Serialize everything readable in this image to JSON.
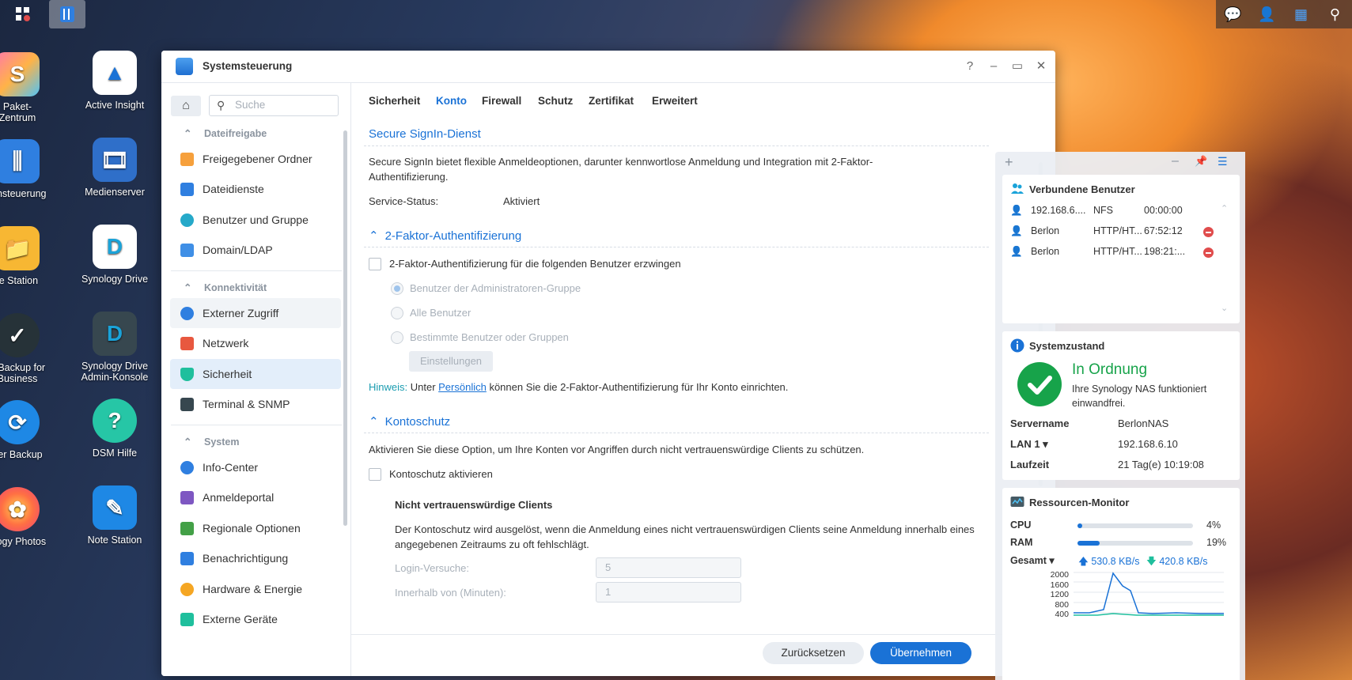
{
  "desktop": {
    "icons": [
      {
        "label": "Paket-\nZentrum"
      },
      {
        "label": "Active Insight"
      },
      {
        "label": "emsteuerung"
      },
      {
        "label": "Medienserver"
      },
      {
        "label": "le Station"
      },
      {
        "label": "Synology Drive"
      },
      {
        "label": "e Backup for\nBusiness"
      },
      {
        "label": "Synology Drive\nAdmin-Konsole"
      },
      {
        "label": "per Backup"
      },
      {
        "label": "DSM Hilfe"
      },
      {
        "label": "ology Photos"
      },
      {
        "label": "Note Station"
      }
    ]
  },
  "window": {
    "title": "Systemsteuerung",
    "controls": {
      "help": "?",
      "minimize": "–",
      "maximize": "▭",
      "close": "✕"
    }
  },
  "sidebar": {
    "search_placeholder": "Suche",
    "sections": [
      {
        "label": "Dateifreigabe"
      },
      {
        "label": "Konnektivität"
      },
      {
        "label": "System"
      }
    ],
    "items": [
      {
        "label": "Freigegebener Ordner"
      },
      {
        "label": "Dateidienste"
      },
      {
        "label": "Benutzer und Gruppe"
      },
      {
        "label": "Domain/LDAP"
      },
      {
        "label": "Externer Zugriff"
      },
      {
        "label": "Netzwerk"
      },
      {
        "label": "Sicherheit"
      },
      {
        "label": "Terminal & SNMP"
      },
      {
        "label": "Info-Center"
      },
      {
        "label": "Anmeldeportal"
      },
      {
        "label": "Regionale Optionen"
      },
      {
        "label": "Benachrichtigung"
      },
      {
        "label": "Hardware & Energie"
      },
      {
        "label": "Externe Geräte"
      }
    ]
  },
  "tabs": [
    {
      "label": "Sicherheit"
    },
    {
      "label": "Konto"
    },
    {
      "label": "Firewall"
    },
    {
      "label": "Schutz"
    },
    {
      "label": "Zertifikat"
    },
    {
      "label": "Erweitert"
    }
  ],
  "signin": {
    "title": "Secure SignIn-Dienst",
    "description": "Secure SignIn bietet flexible Anmeldeoptionen, darunter kennwortlose Anmeldung und Integration mit 2-Faktor-Authentifizierung.",
    "status_label": "Service-Status:",
    "status_value": "Aktiviert"
  },
  "twofa": {
    "title": "2-Faktor-Authentifizierung",
    "enforce_label": "2-Faktor-Authentifizierung für die folgenden Benutzer erzwingen",
    "options": [
      {
        "label": "Benutzer der Administratoren-Gruppe"
      },
      {
        "label": "Alle Benutzer"
      },
      {
        "label": "Bestimmte Benutzer oder Gruppen"
      }
    ],
    "settings_button": "Einstellungen",
    "hint_prefix": "Hinweis:",
    "hint_text_1": " Unter ",
    "hint_link": "Persönlich",
    "hint_text_2": " können Sie die 2-Faktor-Authentifizierung für Ihr Konto einrichten."
  },
  "account_protection": {
    "title": "Kontoschutz",
    "description": "Aktivieren Sie diese Option, um Ihre Konten vor Angriffen durch nicht vertrauenswürdige Clients zu schützen.",
    "enable_label": "Kontoschutz aktivieren",
    "untrusted_title": "Nicht vertrauenswürdige Clients",
    "untrusted_desc": "Der Kontoschutz wird ausgelöst, wenn die Anmeldung eines nicht vertrauenswürdigen Clients seine Anmeldung innerhalb eines angegebenen Zeitraums zu oft fehlschlägt.",
    "login_attempts_label": "Login-Versuche:",
    "login_attempts_value": "5",
    "within_label": "Innerhalb von (Minuten):",
    "within_value": "1"
  },
  "footer": {
    "reset": "Zurücksetzen",
    "apply": "Übernehmen"
  },
  "widgets": {
    "connected_users": {
      "title": "Verbundene Benutzer",
      "rows": [
        {
          "user": "192.168.6....",
          "protocol": "NFS",
          "time": "00:00:00"
        },
        {
          "user": "Berlon",
          "protocol": "HTTP/HT...",
          "time": "67:52:12"
        },
        {
          "user": "Berlon",
          "protocol": "HTTP/HT...",
          "time": "198:21:..."
        }
      ]
    },
    "system_health": {
      "title": "Systemzustand",
      "status": "In Ordnung",
      "message": "Ihre Synology NAS funktioniert einwandfrei.",
      "server_name_label": "Servername",
      "server_name": "BerlonNAS",
      "lan_label": "LAN 1 ▾",
      "lan_ip": "192.168.6.10",
      "uptime_label": "Laufzeit",
      "uptime": "21 Tag(e) 10:19:08"
    },
    "resource_monitor": {
      "title": "Ressourcen-Monitor",
      "cpu_label": "CPU",
      "cpu_value": "4%",
      "cpu_fraction": 0.04,
      "ram_label": "RAM",
      "ram_value": "19%",
      "ram_fraction": 0.19,
      "net_label": "Gesamt ▾",
      "upload": "530.8 KB/s",
      "download": "420.8 KB/s",
      "y_ticks": [
        "2000",
        "1600",
        "1200",
        "800",
        "400"
      ]
    }
  },
  "colors": {
    "accent": "#1a72d6",
    "ok_green": "#17a34a",
    "danger": "#e04c4c"
  }
}
